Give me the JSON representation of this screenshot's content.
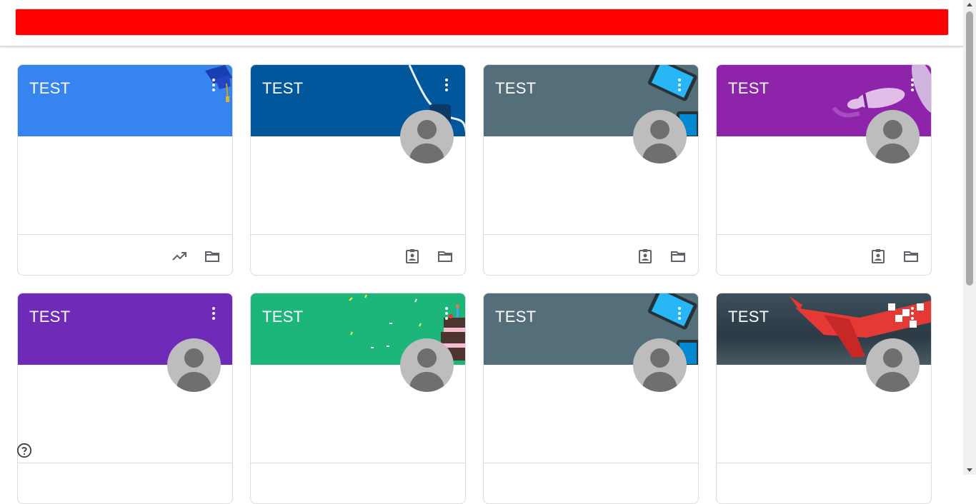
{
  "cards": [
    {
      "title": "TEST",
      "color": "#3584f0",
      "avatar": false,
      "deco": "graduation-cap",
      "footer_icons": [
        "trending-up-icon",
        "folder-icon"
      ]
    },
    {
      "title": "TEST",
      "color": "#01579b",
      "avatar": true,
      "deco": "cable",
      "footer_icons": [
        "assignment-ind-icon",
        "folder-icon"
      ]
    },
    {
      "title": "TEST",
      "color": "#546e7a",
      "avatar": true,
      "deco": "phone",
      "footer_icons": [
        "assignment-ind-icon",
        "folder-icon"
      ]
    },
    {
      "title": "TEST",
      "color": "#8e24aa",
      "avatar": true,
      "deco": "bowling",
      "footer_icons": [
        "assignment-ind-icon",
        "folder-icon"
      ]
    },
    {
      "title": "TEST",
      "color": "#6f2ab8",
      "avatar": true,
      "deco": "none",
      "footer_icons": []
    },
    {
      "title": "TEST",
      "color": "#1db67a",
      "avatar": true,
      "deco": "cake",
      "footer_icons": []
    },
    {
      "title": "TEST",
      "color": "#546e7a",
      "avatar": true,
      "deco": "phone",
      "footer_icons": []
    },
    {
      "title": "TEST",
      "color": "#37474f",
      "avatar": true,
      "deco": "airplane",
      "footer_icons": []
    }
  ],
  "topbar": {
    "accent": "#ff0000"
  },
  "help_icon": "help-circle-icon"
}
